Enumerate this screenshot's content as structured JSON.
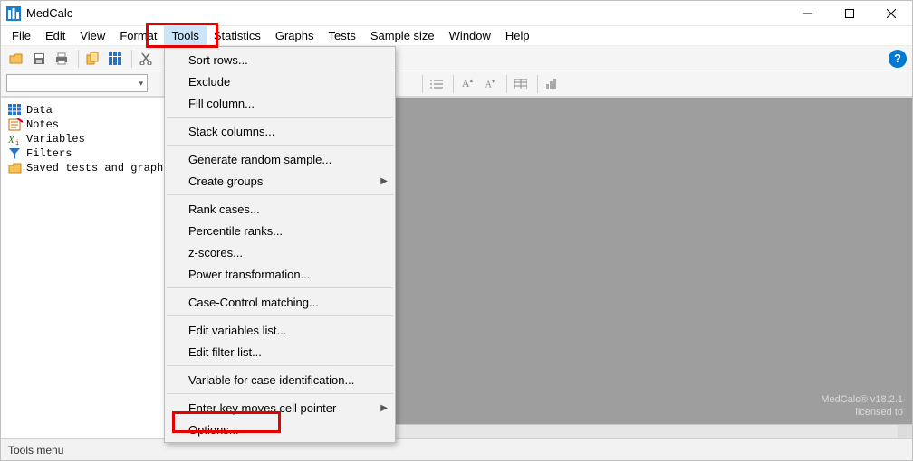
{
  "title": "MedCalc",
  "menubar": {
    "items": [
      "File",
      "Edit",
      "View",
      "Format",
      "Tools",
      "Statistics",
      "Graphs",
      "Tests",
      "Sample size",
      "Window",
      "Help"
    ],
    "active_index": 4
  },
  "tools_menu": {
    "groups": [
      [
        {
          "label": "Sort rows...",
          "submenu": false
        },
        {
          "label": "Exclude",
          "submenu": false
        },
        {
          "label": "Fill column...",
          "submenu": false
        }
      ],
      [
        {
          "label": "Stack columns...",
          "submenu": false
        }
      ],
      [
        {
          "label": "Generate random sample...",
          "submenu": false
        },
        {
          "label": "Create groups",
          "submenu": true
        }
      ],
      [
        {
          "label": "Rank cases...",
          "submenu": false
        },
        {
          "label": "Percentile ranks...",
          "submenu": false
        },
        {
          "label": "z-scores...",
          "submenu": false
        },
        {
          "label": "Power transformation...",
          "submenu": false
        }
      ],
      [
        {
          "label": "Case-Control matching...",
          "submenu": false
        }
      ],
      [
        {
          "label": "Edit variables list...",
          "submenu": false
        },
        {
          "label": "Edit filter list...",
          "submenu": false
        }
      ],
      [
        {
          "label": "Variable for case identification...",
          "submenu": false
        }
      ],
      [
        {
          "label": "Enter key moves cell pointer",
          "submenu": true
        },
        {
          "label": "Options...",
          "submenu": false
        }
      ]
    ]
  },
  "tree": {
    "items": [
      {
        "label": "Data",
        "icon": "grid"
      },
      {
        "label": "Notes",
        "icon": "note"
      },
      {
        "label": "Variables",
        "icon": "xvar"
      },
      {
        "label": "Filters",
        "icon": "funnel"
      },
      {
        "label": "Saved tests and graphs",
        "icon": "folder"
      }
    ]
  },
  "statusbar": {
    "text": "Tools menu"
  },
  "watermark": {
    "line1": "MedCalc® v18.2.1",
    "line2": "licensed to"
  },
  "highlights": {
    "options_index_overall": 15
  },
  "combo": {
    "value": ""
  }
}
